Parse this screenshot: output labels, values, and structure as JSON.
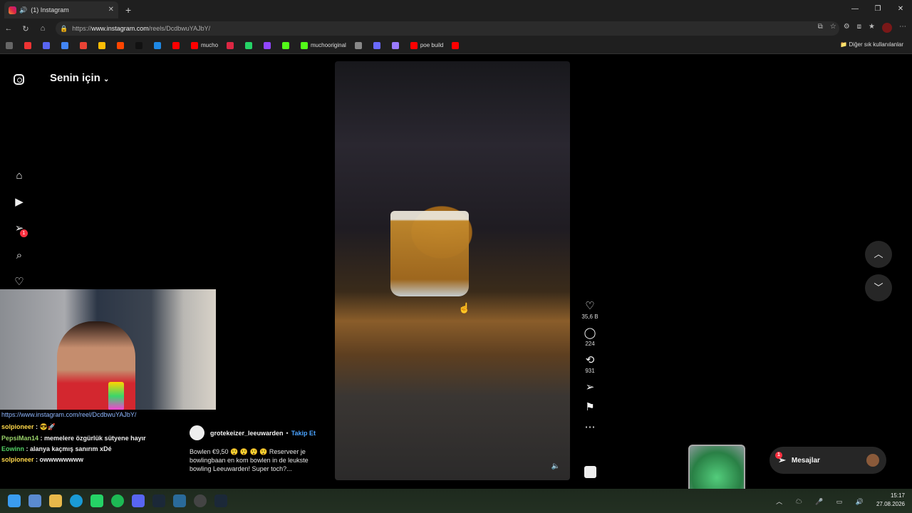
{
  "browser": {
    "tab_title": "(1) Instagram",
    "url_prefix": "https://",
    "url_host": "www.instagram.com",
    "url_path": "/reels/DcdbwuYAJbY/",
    "bookmarks": [
      "mucho",
      "muchooriginal",
      "poe build"
    ],
    "bookmarks_other": "Diğer sık kullanılanlar"
  },
  "instagram": {
    "feed_title": "Senin için",
    "notification_badge": "1",
    "actions": {
      "likes": "35,6 B",
      "comments": "224",
      "reposts": "931"
    },
    "author": "grotekeizer_leeuwarden",
    "follow_label": "Takip Et",
    "caption": "Bowlen €9,50 😲 😲 😲 😲 Reserveer je bowlingbaan en kom bowlen in de leukste bowling Leeuwarden! Super toch?...",
    "messages_label": "Mesajlar",
    "messages_badge": "1"
  },
  "stream_chat": {
    "link": "https://www.instagram.com/reel/DcdbwuYAJbY/",
    "messages": [
      {
        "user": "solpioneer",
        "text": " : 😎🚀"
      },
      {
        "user": "PepsiMan14",
        "text": " : memelere özgürlük sütyene hayır"
      },
      {
        "user": "Eowinn",
        "text": " : alanya kaçmış sanırım xDé"
      },
      {
        "user": "solpioneer",
        "text": " : owwwwwwww"
      }
    ]
  },
  "system": {
    "time": "15:17",
    "date": "27.08.2026"
  },
  "colors": {
    "accent_blue": "#4aa3ff",
    "badge_red": "#ff3040",
    "background": "#000000"
  }
}
